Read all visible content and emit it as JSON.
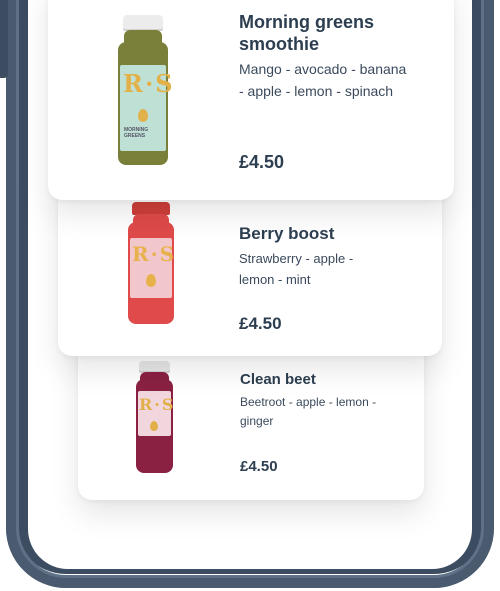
{
  "products": [
    {
      "name": "Morning greens smoothie",
      "description": "Mango - avocado - banana - apple - lemon - spinach",
      "price": "£4.50",
      "bottle": {
        "cap": "#e9e9e9",
        "body": "#7a7f3a",
        "label": "#bfe0d4",
        "mark": "#e3b14a"
      }
    },
    {
      "name": "Berry boost",
      "description": "Strawberry - apple - lemon - mint",
      "price": "£4.50",
      "bottle": {
        "cap": "#c9423b",
        "body": "#e04a4a",
        "label": "#f2c7cc",
        "mark": "#e7b24c"
      }
    },
    {
      "name": "Clean beet",
      "description": "Beetroot - apple - lemon - ginger",
      "price": "£4.50",
      "bottle": {
        "cap": "#e6e6e6",
        "body": "#8b2142",
        "label": "#f1d7dd",
        "mark": "#e2b04a"
      }
    }
  ],
  "colors": {
    "phone_frame": "#4a5b70",
    "text_primary": "#2c3e50",
    "text_secondary": "#3a4a5c"
  }
}
